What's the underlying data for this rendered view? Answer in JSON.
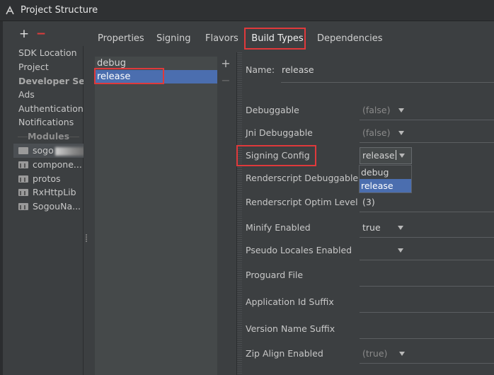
{
  "window": {
    "title": "Project Structure"
  },
  "toolbar": {
    "add": "+",
    "remove": "−"
  },
  "sidebar": {
    "items": [
      "SDK Location",
      "Project"
    ],
    "dev_header": "Developer Se...",
    "dev_items": [
      "Ads",
      "Authentication",
      "Notifications"
    ],
    "modules_header": "Modules",
    "modules": [
      "sogo",
      "compone...",
      "protos",
      "RxHttpLib",
      "SogouNa..."
    ]
  },
  "tabs": [
    "Properties",
    "Signing",
    "Flavors",
    "Build Types",
    "Dependencies"
  ],
  "active_tab": "Build Types",
  "build_types": {
    "items": [
      "debug",
      "release"
    ],
    "selected": "release",
    "add": "+",
    "remove": "−"
  },
  "form": {
    "name_label": "Name:",
    "name_value": "release",
    "fields": [
      {
        "label": "Debuggable",
        "value": "(false)"
      },
      {
        "label": "Jni Debuggable",
        "value": "(false)"
      },
      {
        "label": "Signing Config",
        "value": "release"
      },
      {
        "label": "Renderscript Debuggable",
        "value": ""
      },
      {
        "label": "Renderscript Optim Level",
        "value": "(3)"
      },
      {
        "label": "Minify Enabled",
        "value": "true"
      },
      {
        "label": "Pseudo Locales Enabled",
        "value": ""
      },
      {
        "label": "Proguard File",
        "value": ""
      },
      {
        "label": "Application Id Suffix",
        "value": ""
      },
      {
        "label": "Version Name Suffix",
        "value": ""
      },
      {
        "label": "Zip Align Enabled",
        "value": "(true)"
      }
    ]
  },
  "signing_dropdown": {
    "options": [
      "debug",
      "release"
    ],
    "selected": "release"
  },
  "colors": {
    "highlight": "#e0393b",
    "selection": "#4b6eaf"
  }
}
